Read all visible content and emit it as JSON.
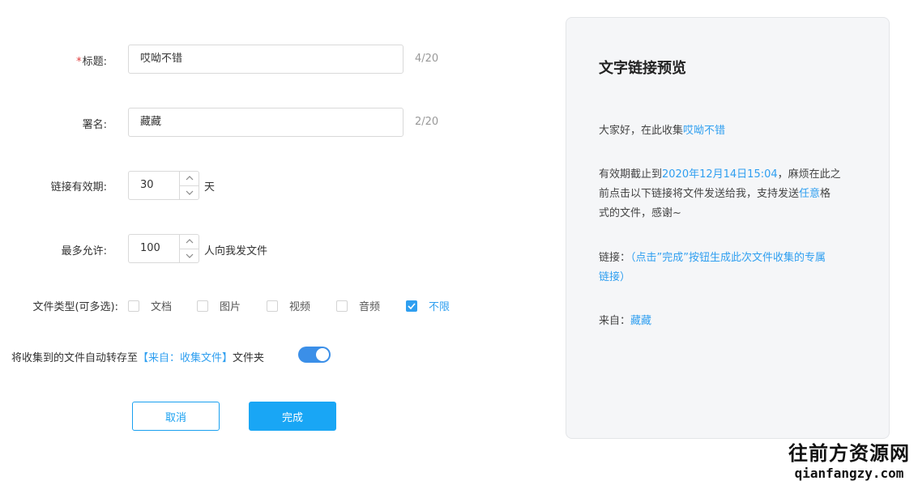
{
  "form": {
    "title": {
      "required_mark": "*",
      "label": "标题:",
      "value": "哎呦不错",
      "counter": "4/20"
    },
    "signature": {
      "label": "署名:",
      "value": "藏藏",
      "counter": "2/20"
    },
    "validity": {
      "label": "链接有效期:",
      "value": "30",
      "suffix": "天"
    },
    "max_allowed": {
      "label": "最多允许:",
      "value": "100",
      "suffix": "人向我发文件"
    },
    "file_types": {
      "label": "文件类型(可多选):",
      "options": [
        {
          "label": "文档",
          "checked": false
        },
        {
          "label": "图片",
          "checked": false
        },
        {
          "label": "视频",
          "checked": false
        },
        {
          "label": "音频",
          "checked": false
        },
        {
          "label": "不限",
          "checked": true
        }
      ]
    },
    "autosave": {
      "prefix": "将收集到的文件自动转存至",
      "folder": "【来自：收集文件】",
      "suffix": "文件夹",
      "enabled": true
    },
    "buttons": {
      "cancel": "取消",
      "done": "完成"
    }
  },
  "preview": {
    "heading": "文字链接预览",
    "greeting_prefix": "大家好，在此收集",
    "greeting_title": "哎呦不错",
    "deadline_prefix": "有效期截止到",
    "deadline_date": "2020年12月14日15:04",
    "deadline_suffix_1": "，麻烦在此之",
    "line2_prefix": "前点击以下链接将文件发送给我，支持发送",
    "line2_any": "任意",
    "line2_suffix": "格",
    "line3": "式的文件，感谢~",
    "link_label": "链接：",
    "link_text_1": "（点击”完成”按钮生成此次文件收集的专属",
    "link_text_2": "链接）",
    "from_label": "来自：",
    "from_value": "藏藏"
  },
  "watermark": {
    "line1": "往前方资源网",
    "line2": "qianfangzy.com"
  },
  "colors": {
    "accent": "#2f9ff0",
    "primary_button": "#19a6f5",
    "switch": "#3b8fe8",
    "required": "#e04040"
  }
}
